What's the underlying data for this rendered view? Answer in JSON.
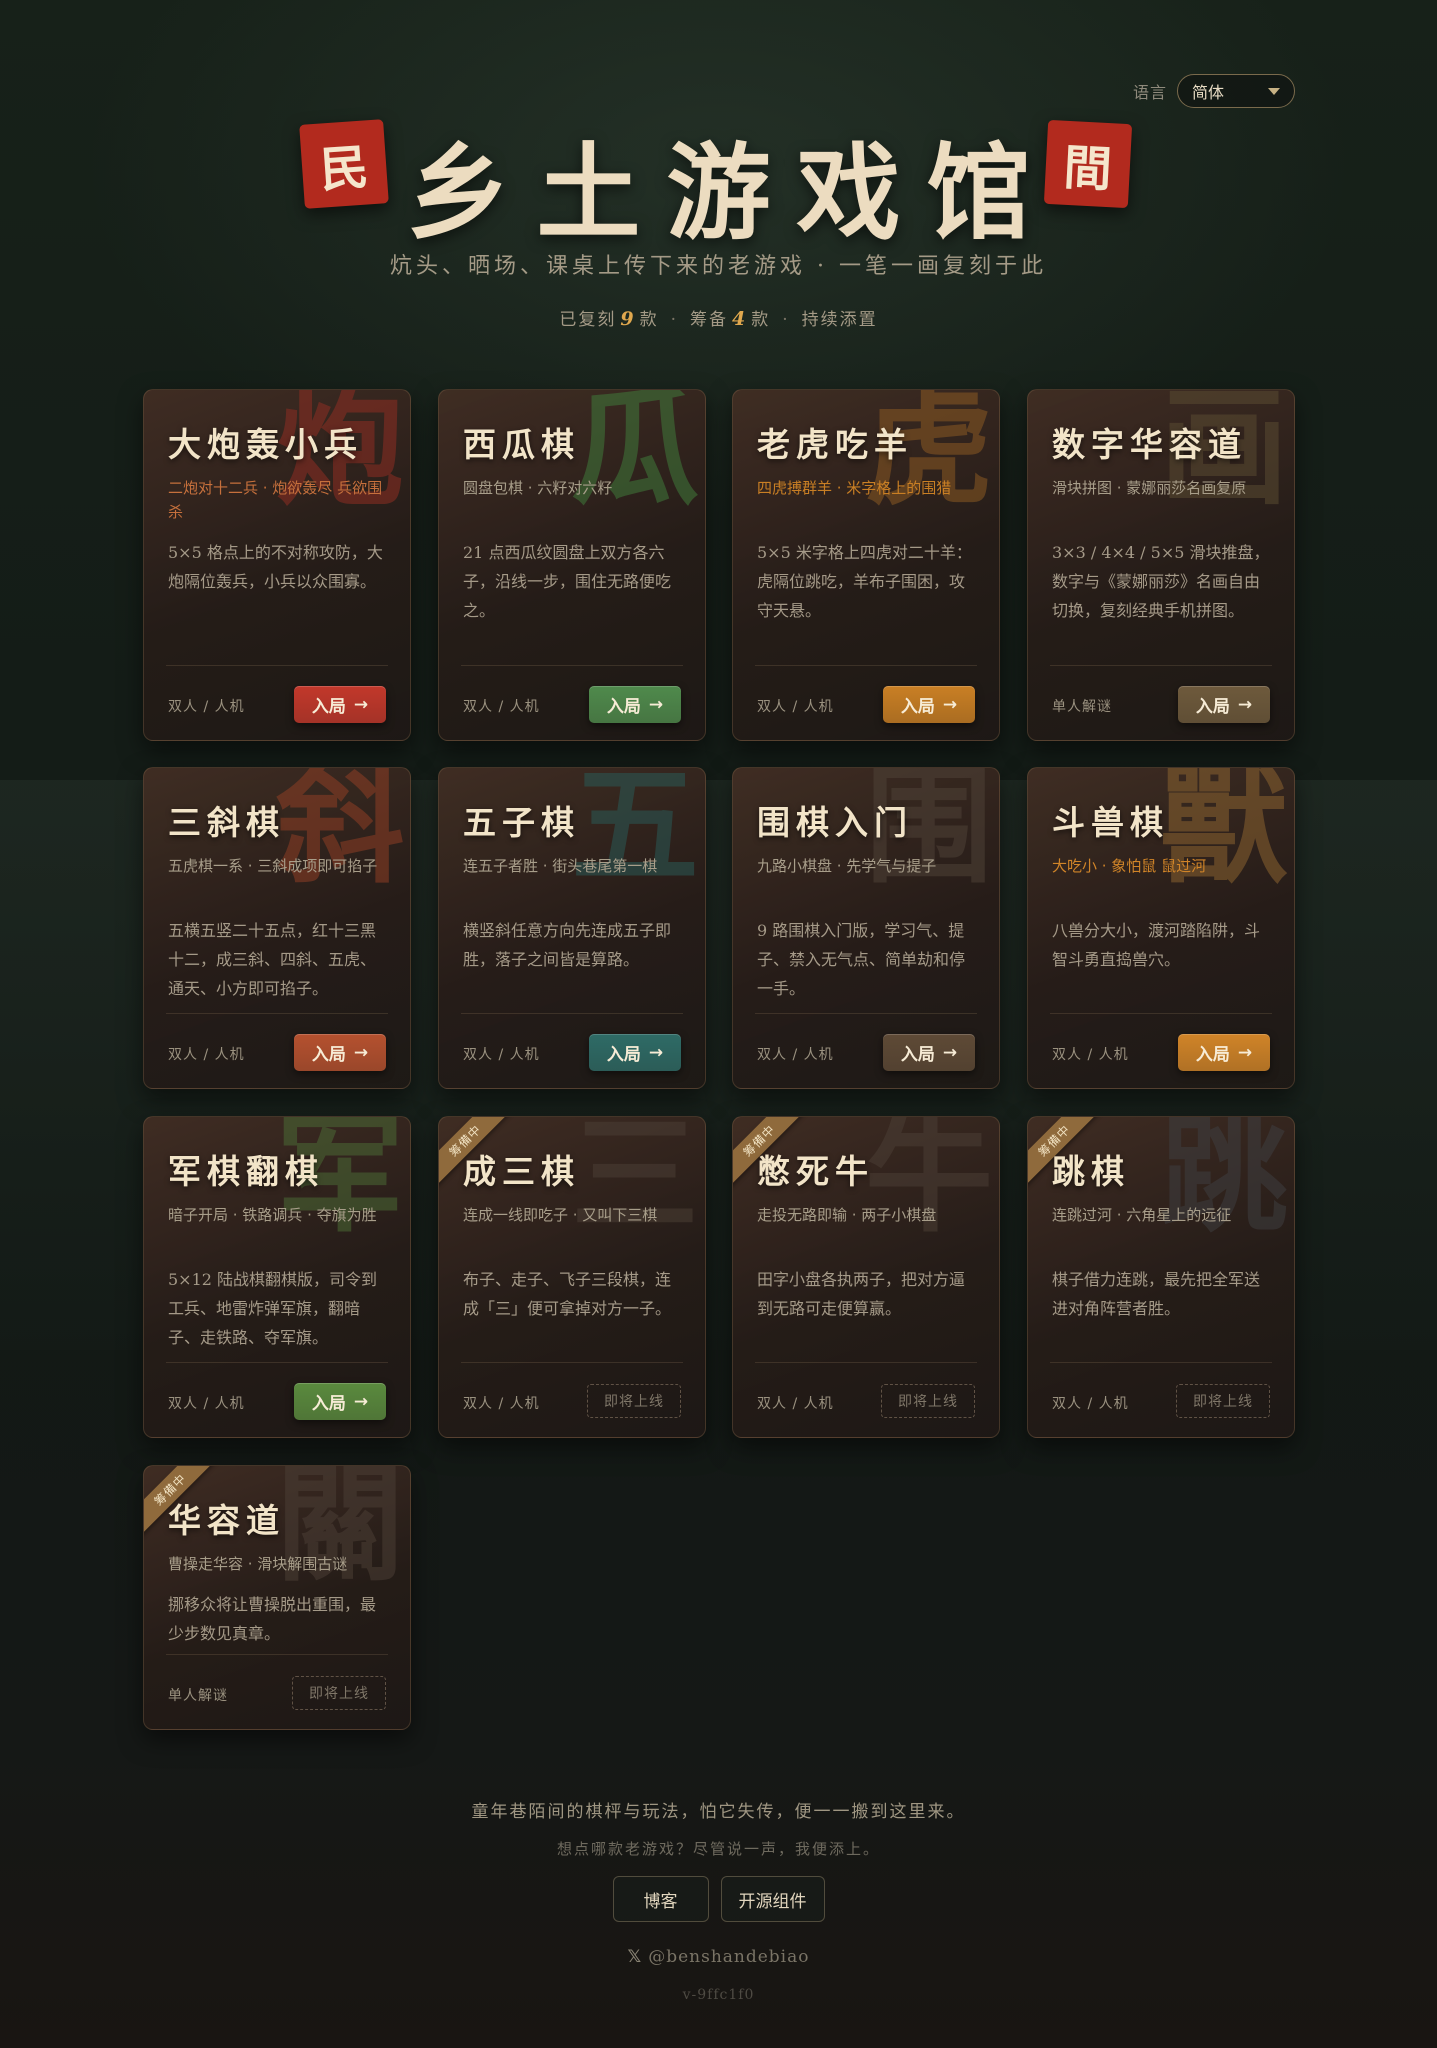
{
  "header": {
    "lang_label": "语言",
    "lang_value": "简体",
    "seal_left": "民",
    "seal_right": "間",
    "title": "乡土游戏馆",
    "subtitle": "炕头、晒场、课桌上传下来的老游戏 · 一笔一画复刻于此",
    "stats": {
      "replicated_label": "已复刻",
      "replicated_count": "9",
      "unit1": "款",
      "sep1": "·",
      "planned_label": "筹备",
      "planned_count": "4",
      "unit2": "款",
      "sep2": "·",
      "ongoing": "持续添置"
    }
  },
  "cards": [
    {
      "title": "大炮轰小兵",
      "watermark": "炮",
      "tag": "二炮对十二兵 · 炮欲轰尽 兵欲围杀",
      "desc": "5×5 格点上的不对称攻防，大炮隔位轰兵，小兵以众围寡。",
      "mode": "双人 / 人机",
      "action": "入局",
      "arrow": "→",
      "accent": "#c2382b",
      "tag_color": "#c6703c",
      "watermark_color": "#8e2e22"
    },
    {
      "title": "西瓜棋",
      "watermark": "瓜",
      "tag": "圆盘包棋 · 六籽对六籽",
      "desc": "21 点西瓜纹圆盘上双方各六子，沿线一步，围住无路便吃之。",
      "mode": "双人 / 人机",
      "action": "入局",
      "arrow": "→",
      "accent": "#4f8a4c",
      "tag_color": "#a89e8a",
      "watermark_color": "#3f7a3a"
    },
    {
      "title": "老虎吃羊",
      "watermark": "虎",
      "tag": "四虎搏群羊 · 米字格上的围猎",
      "desc": "5×5 米字格上四虎对二十羊：虎隔位跳吃，羊布子围困，攻守天悬。",
      "mode": "双人 / 人机",
      "action": "入局",
      "arrow": "→",
      "accent": "#c97f24",
      "tag_color": "#c97f24",
      "watermark_color": "#8a5a22"
    },
    {
      "title": "数字华容道",
      "watermark": "画",
      "tag": "滑块拼图 · 蒙娜丽莎名画复原",
      "desc": "3×3 / 4×4 / 5×5 滑块推盘，数字与《蒙娜丽莎》名画自由切换，复刻经典手机拼图。",
      "mode": "单人解谜",
      "action": "入局",
      "arrow": "→",
      "accent": "#6e5a3c",
      "tag_color": "#a89e8a",
      "watermark_color": "#5a4a32"
    },
    {
      "title": "三斜棋",
      "watermark": "斜",
      "tag": "五虎棋一系 · 三斜成项即可掐子",
      "desc": "五横五竖二十五点，红十三黑十二，成三斜、四斜、五虎、通天、小方即可掐子。",
      "mode": "双人 / 人机",
      "action": "入局",
      "arrow": "→",
      "accent": "#b5512f",
      "tag_color": "#a89e8a",
      "watermark_color": "#8e3e24"
    },
    {
      "title": "五子棋",
      "watermark": "五",
      "tag": "连五子者胜 · 街头巷尾第一棋",
      "desc": "横竖斜任意方向先连成五子即胜，落子之间皆是算路。",
      "mode": "双人 / 人机",
      "action": "入局",
      "arrow": "→",
      "accent": "#2e6b66",
      "tag_color": "#a89e8a",
      "watermark_color": "#2a5a56"
    },
    {
      "title": "围棋入门",
      "watermark": "围",
      "tag": "九路小棋盘 · 先学气与提子",
      "desc": "9 路围棋入门版，学习气、提子、禁入无气点、简单劫和停一手。",
      "mode": "双人 / 人机",
      "action": "入局",
      "arrow": "→",
      "accent": "#5e4a36",
      "tag_color": "#a89e8a",
      "watermark_color": "#4e4236"
    },
    {
      "title": "斗兽棋",
      "watermark": "獸",
      "tag": "大吃小 · 象怕鼠 鼠过河",
      "desc": "八兽分大小，渡河踏陷阱，斗智斗勇直捣兽穴。",
      "mode": "双人 / 人机",
      "action": "入局",
      "arrow": "→",
      "accent": "#d08428",
      "tag_color": "#d08428",
      "watermark_color": "#8a6230"
    },
    {
      "title": "军棋翻棋",
      "watermark": "军",
      "tag": "暗子开局 · 铁路调兵 · 夺旗为胜",
      "desc": "5×12 陆战棋翻棋版，司令到工兵、地雷炸弹军旗，翻暗子、走铁路、夺军旗。",
      "mode": "双人 / 人机",
      "action": "入局",
      "arrow": "→",
      "accent": "#5a8a3e",
      "tag_color": "#a89e8a",
      "watermark_color": "#4a6a34"
    },
    {
      "title": "成三棋",
      "watermark": "三",
      "ribbon": "筹備中",
      "tag": "连成一线即吃子 · 又叫下三棋",
      "desc": "布子、走子、飞子三段棋，连成「三」便可拿掉对方一子。",
      "mode": "双人 / 人机",
      "soon": "即将上线",
      "tag_color": "#a89e8a",
      "watermark_color": "#4a3e34"
    },
    {
      "title": "憋死牛",
      "watermark": "牛",
      "ribbon": "筹備中",
      "tag": "走投无路即输 · 两子小棋盘",
      "desc": "田字小盘各执两子，把对方逼到无路可走便算赢。",
      "mode": "双人 / 人机",
      "soon": "即将上线",
      "tag_color": "#a89e8a",
      "watermark_color": "#4a3e34"
    },
    {
      "title": "跳棋",
      "watermark": "跳",
      "ribbon": "筹備中",
      "tag": "连跳过河 · 六角星上的远征",
      "desc": "棋子借力连跳，最先把全军送进对角阵营者胜。",
      "mode": "双人 / 人机",
      "soon": "即将上线",
      "tag_color": "#a89e8a",
      "watermark_color": "#3e3e40"
    },
    {
      "title": "华容道",
      "watermark": "關",
      "ribbon": "筹備中",
      "tag": "曹操走华容 · 滑块解围古谜",
      "desc": "挪移众将让曹操脱出重围，最少步数见真章。",
      "mode": "单人解谜",
      "soon": "即将上线",
      "tag_color": "#a89e8a",
      "watermark_color": "#4a3e34"
    }
  ],
  "footer": {
    "line1": "童年巷陌间的棋枰与玩法，怕它失传，便一一搬到这里来。",
    "line2": "想点哪款老游戏？尽管说一声，我便添上。",
    "blog": "博客",
    "open_source": "开源组件",
    "x_glyph": "𝕏",
    "handle": "@benshandebiao",
    "version": "v-9ffc1f0"
  }
}
